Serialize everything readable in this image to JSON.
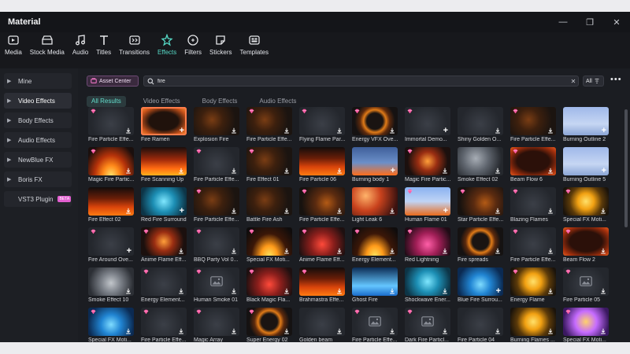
{
  "app": {
    "title": "Material"
  },
  "window_controls": {
    "minimize": "—",
    "restore": "❐",
    "close": "✕"
  },
  "toolbar": [
    {
      "label": "Media",
      "icon": "media-icon"
    },
    {
      "label": "Stock Media",
      "icon": "stock-media-icon"
    },
    {
      "label": "Audio",
      "icon": "audio-icon"
    },
    {
      "label": "Titles",
      "icon": "titles-icon"
    },
    {
      "label": "Transitions",
      "icon": "transitions-icon"
    },
    {
      "label": "Effects",
      "icon": "effects-icon",
      "active": true
    },
    {
      "label": "Filters",
      "icon": "filters-icon"
    },
    {
      "label": "Stickers",
      "icon": "stickers-icon"
    },
    {
      "label": "Templates",
      "icon": "templates-icon"
    }
  ],
  "sidebar": {
    "items": [
      {
        "label": "Mine"
      },
      {
        "label": "Video Effects",
        "active": true
      },
      {
        "label": "Body Effects"
      },
      {
        "label": "Audio Effects"
      },
      {
        "label": "NewBlue FX"
      },
      {
        "label": "Boris FX"
      },
      {
        "label": "VST3 Plugin",
        "badge": "BETA"
      }
    ]
  },
  "asset_center": {
    "label": "Asset Center"
  },
  "search": {
    "value": "fire",
    "placeholder": "Search"
  },
  "sort": {
    "label": "All"
  },
  "filter_tabs": [
    {
      "label": "All Results",
      "active": true
    },
    {
      "label": "Video Effects"
    },
    {
      "label": "Body Effects"
    },
    {
      "label": "Audio Effects"
    }
  ],
  "colors": {
    "accent": "#56d9c6",
    "premium": "#ff5aa5",
    "selection": "#ff7c49"
  },
  "effects": [
    {
      "label": "Fire Particle Effe...",
      "style": "t-dark",
      "premium": true,
      "action": "download"
    },
    {
      "label": "Fire Ramen",
      "style": "t-frame",
      "premium": false,
      "action": "plus",
      "selected": true
    },
    {
      "label": "Explosion Fire",
      "style": "t-emb",
      "premium": false,
      "action": "download"
    },
    {
      "label": "Fire Particle Effe...",
      "style": "t-emb",
      "premium": true,
      "action": "download"
    },
    {
      "label": "Flying Flame Par...",
      "style": "t-dark",
      "premium": true,
      "action": "download"
    },
    {
      "label": "Energy VFX Ove...",
      "style": "t-ring",
      "premium": true,
      "action": "download"
    },
    {
      "label": "Immortal Demo...",
      "style": "t-dark",
      "premium": true,
      "action": "plus"
    },
    {
      "label": "Shiny Golden O...",
      "style": "t-dark",
      "premium": false,
      "action": "download"
    },
    {
      "label": "Fire Particle Effe...",
      "style": "t-emb",
      "premium": true,
      "action": "download"
    },
    {
      "label": "Burning Outline 2",
      "style": "t-person",
      "premium": false,
      "action": "plus"
    },
    {
      "label": "Magic Fire Partic...",
      "style": "t-blaze",
      "premium": true,
      "action": "download"
    },
    {
      "label": "Fire Scanning Up",
      "style": "t-fire2",
      "premium": false,
      "action": "download"
    },
    {
      "label": "Fire Particle Effe...",
      "style": "t-dark",
      "premium": true,
      "action": "download"
    },
    {
      "label": "Fire Effect 01",
      "style": "t-emb",
      "premium": true,
      "action": "download"
    },
    {
      "label": "Fire Particle 06",
      "style": "t-fire",
      "premium": false,
      "action": "download"
    },
    {
      "label": "Burning body 1",
      "style": "t-person-fire",
      "premium": false,
      "action": "plus"
    },
    {
      "label": "Magic Fire Partic...",
      "style": "t-magic",
      "premium": true,
      "action": "download"
    },
    {
      "label": "Smoke Effect 02",
      "style": "t-smoke2",
      "premium": false,
      "action": "download"
    },
    {
      "label": "Beam Flow 6",
      "style": "t-frame2",
      "premium": true,
      "action": "download"
    },
    {
      "label": "Burning Outline 5",
      "style": "t-person",
      "premium": false,
      "action": "plus"
    },
    {
      "label": "Fire Effect 02",
      "style": "t-fire",
      "premium": false,
      "action": "download"
    },
    {
      "label": "Red Fire Surround",
      "style": "t-teal",
      "premium": false,
      "action": "plus"
    },
    {
      "label": "Fire Particle Effe...",
      "style": "t-emb",
      "premium": true,
      "action": "download"
    },
    {
      "label": "Battle Fire Ash",
      "style": "t-emb",
      "premium": false,
      "action": "download"
    },
    {
      "label": "Fire Particle Effe...",
      "style": "t-emb2",
      "premium": true,
      "action": "download"
    },
    {
      "label": "Light Leak 6",
      "style": "t-light",
      "premium": false,
      "action": "download"
    },
    {
      "label": "Human Flame 01",
      "style": "t-sky",
      "premium": true,
      "action": "plus"
    },
    {
      "label": "Star Particle Effe...",
      "style": "t-emb2",
      "premium": true,
      "action": "download"
    },
    {
      "label": "Blazing Flames",
      "style": "t-dark",
      "premium": true,
      "action": "download"
    },
    {
      "label": "Special FX Moti...",
      "style": "t-gold",
      "premium": true,
      "action": "download"
    },
    {
      "label": "Fire Around Ove...",
      "style": "t-dark",
      "premium": true,
      "action": "plus"
    },
    {
      "label": "Anime Flame Eff...",
      "style": "t-magic",
      "premium": true,
      "action": "download"
    },
    {
      "label": "BBQ Party Vol 0...",
      "style": "t-dark",
      "premium": true,
      "action": "download"
    },
    {
      "label": "Special FX Moti...",
      "style": "t-bolt",
      "premium": true,
      "action": "download"
    },
    {
      "label": "Anime Flame Eff...",
      "style": "t-red",
      "premium": true,
      "action": "download"
    },
    {
      "label": "Energy Element...",
      "style": "t-bolt",
      "premium": true,
      "action": "download"
    },
    {
      "label": "Red Lightning",
      "style": "t-pink",
      "premium": true,
      "action": "download"
    },
    {
      "label": "Fire spreads",
      "style": "t-ring",
      "premium": false,
      "action": "download"
    },
    {
      "label": "Fire Particle Effe...",
      "style": "t-dark",
      "premium": true,
      "action": "download"
    },
    {
      "label": "Beam Flow 2",
      "style": "t-frame2",
      "premium": true,
      "action": "download"
    },
    {
      "label": "Smoke Effect 10",
      "style": "t-smoke",
      "premium": false,
      "action": "download"
    },
    {
      "label": "Energy Element...",
      "style": "t-dark",
      "premium": true,
      "action": "download"
    },
    {
      "label": "Human Smoke 01",
      "style": "t-dark",
      "premium": true,
      "action": "image"
    },
    {
      "label": "Black Magic Fla...",
      "style": "t-red",
      "premium": true,
      "action": "download"
    },
    {
      "label": "Brahmastra Effe...",
      "style": "t-fire",
      "premium": true,
      "action": "download"
    },
    {
      "label": "Ghost Fire",
      "style": "t-blue2",
      "premium": false,
      "action": "download"
    },
    {
      "label": "Shockwave Ener...",
      "style": "t-teal",
      "premium": false,
      "action": "download"
    },
    {
      "label": "Blue Fire Surrou...",
      "style": "t-blue",
      "premium": false,
      "action": "plus"
    },
    {
      "label": "Energy Flame",
      "style": "t-gold",
      "premium": true,
      "action": "download"
    },
    {
      "label": "Fire Particle 05",
      "style": "t-dark",
      "premium": true,
      "action": "image"
    },
    {
      "label": "Special FX Moti...",
      "style": "t-blue",
      "premium": true,
      "action": "download"
    },
    {
      "label": "Fire Particle Effe...",
      "style": "t-dark",
      "premium": true,
      "action": "download"
    },
    {
      "label": "Magic Array",
      "style": "t-dark",
      "premium": true,
      "action": "download"
    },
    {
      "label": "Super Energy 02",
      "style": "t-ring",
      "premium": true,
      "action": "download"
    },
    {
      "label": "Golden beam",
      "style": "t-dark",
      "premium": false,
      "action": "download"
    },
    {
      "label": "Fire Particle Effe...",
      "style": "t-dark",
      "premium": true,
      "action": "image"
    },
    {
      "label": "Dark Fire Particl...",
      "style": "t-dark",
      "premium": true,
      "action": "image"
    },
    {
      "label": "Fire Particle 04",
      "style": "t-dark",
      "premium": false,
      "action": "download"
    },
    {
      "label": "Burning Flames ...",
      "style": "t-gold",
      "premium": false,
      "action": "download"
    },
    {
      "label": "Special FX Moti...",
      "style": "t-purple",
      "premium": true,
      "action": "download"
    }
  ]
}
